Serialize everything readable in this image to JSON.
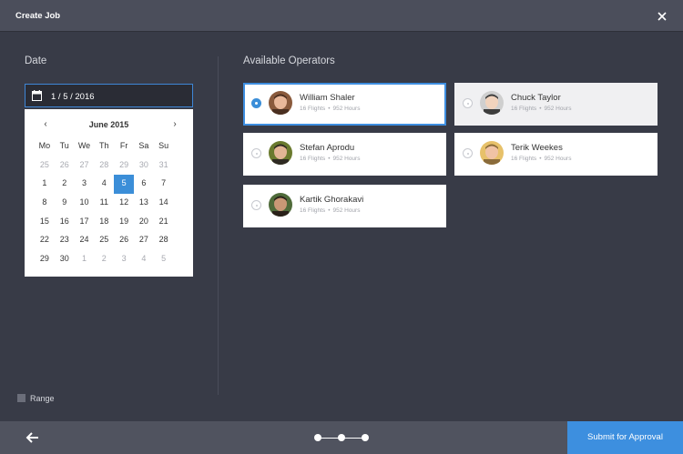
{
  "titlebar": {
    "title": "Create Job",
    "close_icon": "close-icon"
  },
  "date_section": {
    "label": "Date",
    "input_value": "1 / 5 / 2016",
    "calendar": {
      "month": "June 2015",
      "prev": "‹",
      "next": "›",
      "weekdays": [
        "Mo",
        "Tu",
        "We",
        "Th",
        "Fr",
        "Sa",
        "Su"
      ],
      "weeks": [
        [
          "25",
          "26",
          "27",
          "28",
          "29",
          "30",
          "31"
        ],
        [
          "1",
          "2",
          "3",
          "4",
          "5",
          "6",
          "7"
        ],
        [
          "8",
          "9",
          "10",
          "11",
          "12",
          "13",
          "14"
        ],
        [
          "15",
          "16",
          "17",
          "18",
          "19",
          "20",
          "21"
        ],
        [
          "22",
          "23",
          "24",
          "25",
          "26",
          "27",
          "28"
        ],
        [
          "29",
          "30",
          "1",
          "2",
          "3",
          "4",
          "5"
        ]
      ],
      "selected_day": "5"
    }
  },
  "operators_section": {
    "label": "Available Operators",
    "operators": [
      {
        "name": "William Shaler",
        "flights": "16 Flights",
        "hours": "952 Hours",
        "selected": true
      },
      {
        "name": "Chuck Taylor",
        "flights": "16 Flights",
        "hours": "952 Hours",
        "selected": false
      },
      {
        "name": "Stefan Aprodu",
        "flights": "16 Flights",
        "hours": "952 Hours",
        "selected": false
      },
      {
        "name": "Terik Weekes",
        "flights": "16 Flights",
        "hours": "952 Hours",
        "selected": false
      },
      {
        "name": "Kartik Ghorakavi",
        "flights": "16 Flights",
        "hours": "952 Hours",
        "selected": false
      }
    ]
  },
  "range": {
    "label": "Range"
  },
  "footer": {
    "submit_label": "Submit for Approval",
    "back_icon": "back-arrow-icon"
  },
  "colors": {
    "accent": "#3d8fdf",
    "background": "#383b47",
    "titlebar": "#4b4e5b",
    "footer": "#50535f"
  }
}
